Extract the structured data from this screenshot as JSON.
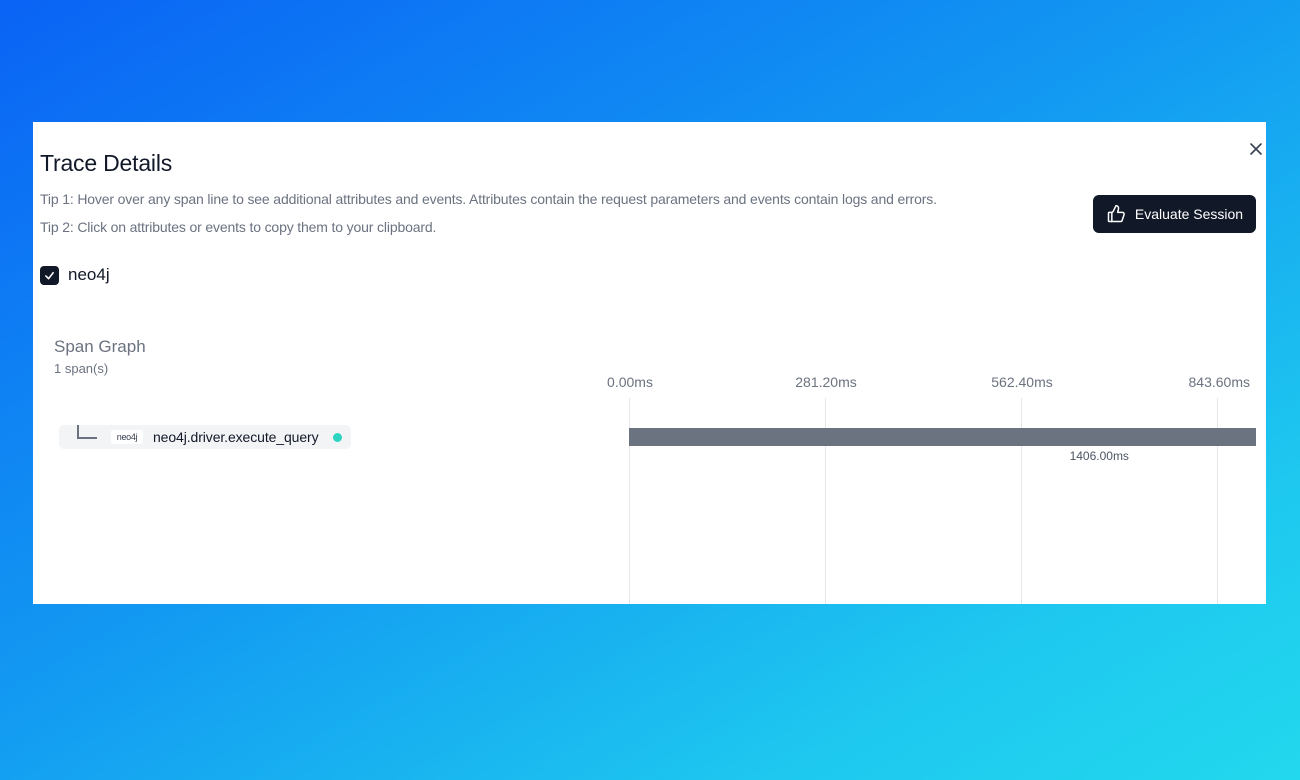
{
  "dialog": {
    "title": "Trace Details",
    "tip1": "Tip 1: Hover over any span line to see additional attributes and events. Attributes contain the request parameters and events contain logs and errors.",
    "tip2": "Tip 2: Click on attributes or events to copy them to your clipboard.",
    "evaluate_label": "Evaluate Session",
    "evaluate_icon": "thumbs-up-icon",
    "close_icon": "close-icon"
  },
  "filters": [
    {
      "label": "neo4j",
      "checked": true
    }
  ],
  "span_graph": {
    "title": "Span Graph",
    "count_label": "1 span(s)",
    "ticks": [
      "0.00ms",
      "281.20ms",
      "562.40ms",
      "843.60ms"
    ],
    "spans": [
      {
        "name": "neo4j.driver.execute_query",
        "logo_text": "neo4j",
        "status_color": "#2dd4bf",
        "start_ms": 0,
        "duration_ms": 1406.0,
        "duration_label": "1406.00ms"
      }
    ]
  },
  "colors": {
    "accent": "#111827",
    "span_bar": "#6b7280",
    "status_ok": "#2dd4bf"
  }
}
